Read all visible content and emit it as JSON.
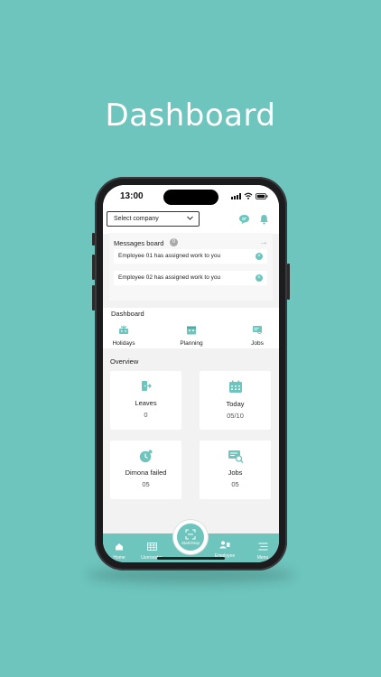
{
  "promo": {
    "title": "Dashboard"
  },
  "status_bar": {
    "time": "13:00"
  },
  "header": {
    "company_select_value": "Select company"
  },
  "messages_board": {
    "title": "Messages board",
    "count": "0",
    "items": [
      {
        "text": "Employee 01 has assigned work to you"
      },
      {
        "text": "Employee 02 has assigned work to you"
      }
    ]
  },
  "dashboard": {
    "title": "Dashboard",
    "items": [
      {
        "label": "Holidays",
        "icon": "holidays-icon"
      },
      {
        "label": "Planning",
        "icon": "planning-icon"
      },
      {
        "label": "Jobs",
        "icon": "jobs-icon"
      }
    ]
  },
  "overview": {
    "title": "Overview",
    "cards": [
      {
        "title": "Leaves",
        "value": "0",
        "icon": "leaves-icon"
      },
      {
        "title": "Today",
        "value": "05/10",
        "icon": "calendar-icon"
      },
      {
        "title": "Dimona failed",
        "value": "05",
        "icon": "clock-icon"
      },
      {
        "title": "Jobs",
        "value": "05",
        "icon": "job-search-icon"
      }
    ]
  },
  "bottom_nav": {
    "items": [
      {
        "label": "Home",
        "icon": "home-icon"
      },
      {
        "label": "Uurrooster",
        "icon": "schedule-icon"
      },
      {
        "label": "Employee",
        "icon": "employee-icon"
      },
      {
        "label": "Menu",
        "icon": "menu-icon"
      }
    ],
    "center_button_label": "Start/Stop"
  },
  "colors": {
    "accent": "#6dc5bd",
    "background": "#f2f2f2"
  }
}
